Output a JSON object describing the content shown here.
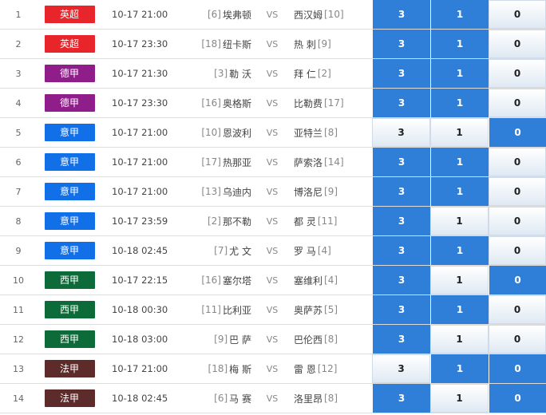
{
  "rows": [
    {
      "idx": "1",
      "league": "英超",
      "color": "#e8252a",
      "time": "10-17 21:00",
      "home_rank": "[6]",
      "home": "埃弗顿",
      "vs": "VS",
      "away": "西汉姆",
      "away_rank": "[10]",
      "odds": [
        "3",
        "1",
        "0"
      ],
      "selected": [
        true,
        true,
        false
      ]
    },
    {
      "idx": "2",
      "league": "英超",
      "color": "#e8252a",
      "time": "10-17 23:30",
      "home_rank": "[18]",
      "home": "纽卡斯",
      "vs": "VS",
      "away": "热 刺",
      "away_rank": "[9]",
      "odds": [
        "3",
        "1",
        "0"
      ],
      "selected": [
        true,
        true,
        false
      ]
    },
    {
      "idx": "3",
      "league": "德甲",
      "color": "#8f1e8b",
      "time": "10-17 21:30",
      "home_rank": "[3]",
      "home": "勒 沃",
      "vs": "VS",
      "away": "拜 仁",
      "away_rank": "[2]",
      "odds": [
        "3",
        "1",
        "0"
      ],
      "selected": [
        true,
        true,
        false
      ]
    },
    {
      "idx": "4",
      "league": "德甲",
      "color": "#8f1e8b",
      "time": "10-17 23:30",
      "home_rank": "[16]",
      "home": "奥格斯",
      "vs": "VS",
      "away": "比勒费",
      "away_rank": "[17]",
      "odds": [
        "3",
        "1",
        "0"
      ],
      "selected": [
        true,
        true,
        false
      ]
    },
    {
      "idx": "5",
      "league": "意甲",
      "color": "#1170e8",
      "time": "10-17 21:00",
      "home_rank": "[10]",
      "home": "恩波利",
      "vs": "VS",
      "away": "亚特兰",
      "away_rank": "[8]",
      "odds": [
        "3",
        "1",
        "0"
      ],
      "selected": [
        false,
        false,
        true
      ]
    },
    {
      "idx": "6",
      "league": "意甲",
      "color": "#1170e8",
      "time": "10-17 21:00",
      "home_rank": "[17]",
      "home": "热那亚",
      "vs": "VS",
      "away": "萨索洛",
      "away_rank": "[14]",
      "odds": [
        "3",
        "1",
        "0"
      ],
      "selected": [
        true,
        true,
        false
      ]
    },
    {
      "idx": "7",
      "league": "意甲",
      "color": "#1170e8",
      "time": "10-17 21:00",
      "home_rank": "[13]",
      "home": "乌迪内",
      "vs": "VS",
      "away": "博洛尼",
      "away_rank": "[9]",
      "odds": [
        "3",
        "1",
        "0"
      ],
      "selected": [
        true,
        true,
        false
      ]
    },
    {
      "idx": "8",
      "league": "意甲",
      "color": "#1170e8",
      "time": "10-17 23:59",
      "home_rank": "[2]",
      "home": "那不勒",
      "vs": "VS",
      "away": "都 灵",
      "away_rank": "[11]",
      "odds": [
        "3",
        "1",
        "0"
      ],
      "selected": [
        true,
        false,
        false
      ]
    },
    {
      "idx": "9",
      "league": "意甲",
      "color": "#1170e8",
      "time": "10-18 02:45",
      "home_rank": "[7]",
      "home": "尤 文",
      "vs": "VS",
      "away": "罗 马",
      "away_rank": "[4]",
      "odds": [
        "3",
        "1",
        "0"
      ],
      "selected": [
        true,
        true,
        false
      ]
    },
    {
      "idx": "10",
      "league": "西甲",
      "color": "#0d6b3a",
      "time": "10-17 22:15",
      "home_rank": "[16]",
      "home": "塞尔塔",
      "vs": "VS",
      "away": "塞维利",
      "away_rank": "[4]",
      "odds": [
        "3",
        "1",
        "0"
      ],
      "selected": [
        true,
        false,
        true
      ]
    },
    {
      "idx": "11",
      "league": "西甲",
      "color": "#0d6b3a",
      "time": "10-18 00:30",
      "home_rank": "[11]",
      "home": "比利亚",
      "vs": "VS",
      "away": "奥萨苏",
      "away_rank": "[5]",
      "odds": [
        "3",
        "1",
        "0"
      ],
      "selected": [
        true,
        true,
        false
      ]
    },
    {
      "idx": "12",
      "league": "西甲",
      "color": "#0d6b3a",
      "time": "10-18 03:00",
      "home_rank": "[9]",
      "home": "巴 萨",
      "vs": "VS",
      "away": "巴伦西",
      "away_rank": "[8]",
      "odds": [
        "3",
        "1",
        "0"
      ],
      "selected": [
        true,
        false,
        false
      ]
    },
    {
      "idx": "13",
      "league": "法甲",
      "color": "#5e2b2b",
      "time": "10-17 21:00",
      "home_rank": "[18]",
      "home": "梅 斯",
      "vs": "VS",
      "away": "雷 恩",
      "away_rank": "[12]",
      "odds": [
        "3",
        "1",
        "0"
      ],
      "selected": [
        false,
        true,
        true
      ]
    },
    {
      "idx": "14",
      "league": "法甲",
      "color": "#5e2b2b",
      "time": "10-18 02:45",
      "home_rank": "[6]",
      "home": "马 赛",
      "vs": "VS",
      "away": "洛里昂",
      "away_rank": "[8]",
      "odds": [
        "3",
        "1",
        "0"
      ],
      "selected": [
        true,
        false,
        true
      ]
    }
  ]
}
